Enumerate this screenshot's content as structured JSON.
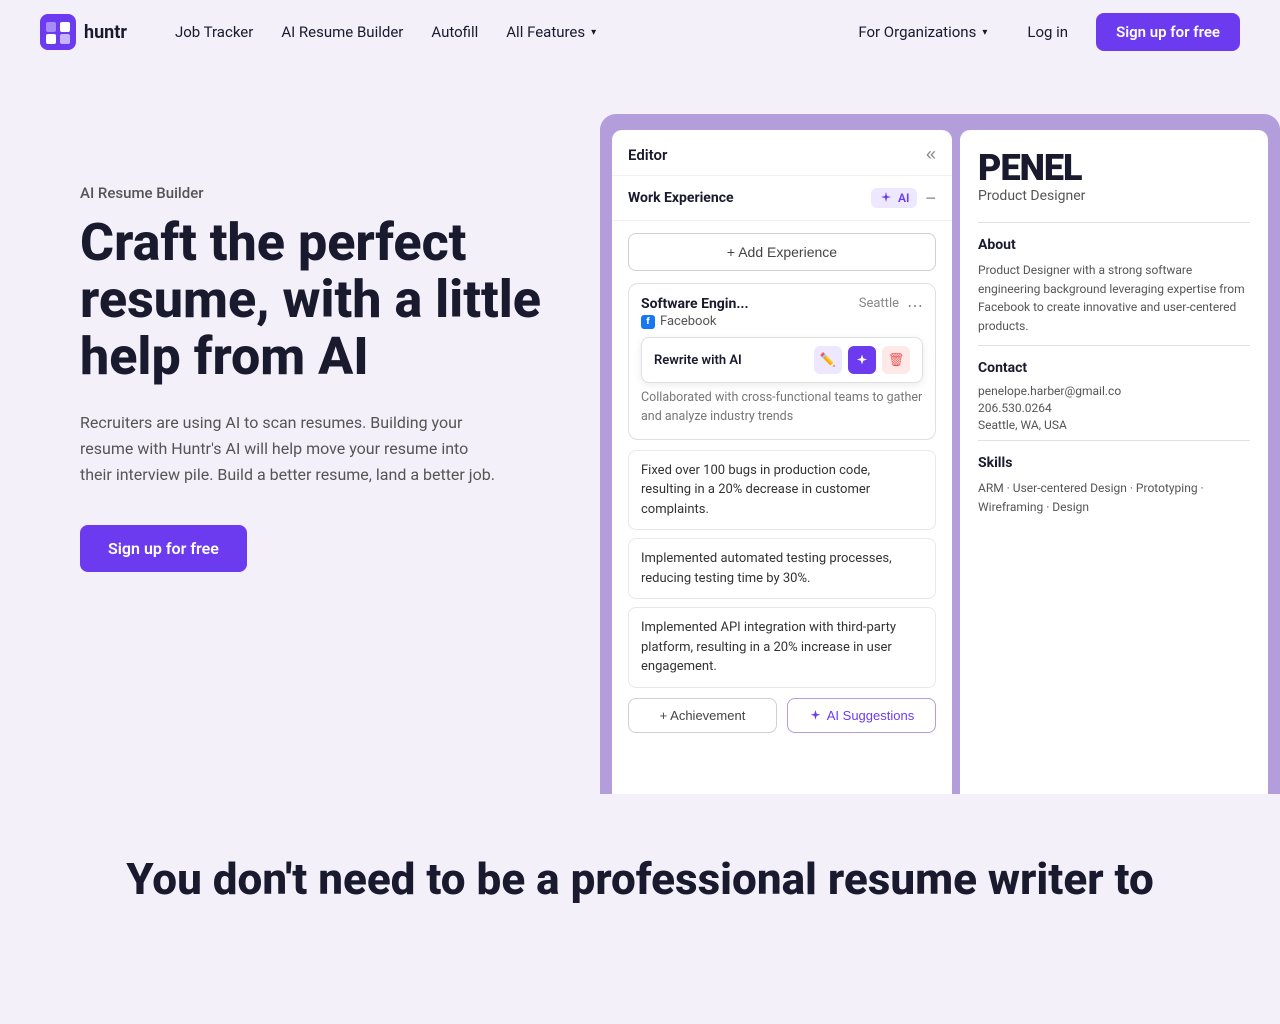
{
  "nav": {
    "logo_text": "huntr",
    "links": [
      {
        "label": "Job Tracker",
        "id": "job-tracker",
        "has_dropdown": false
      },
      {
        "label": "AI Resume Builder",
        "id": "ai-resume-builder",
        "has_dropdown": false
      },
      {
        "label": "Autofill",
        "id": "autofill",
        "has_dropdown": false
      },
      {
        "label": "All Features",
        "id": "all-features",
        "has_dropdown": true
      }
    ],
    "right": {
      "org_label": "For Organizations",
      "login_label": "Log in",
      "signup_label": "Sign up for free"
    }
  },
  "hero": {
    "subtitle": "AI Resume Builder",
    "title": "Craft the perfect resume, with a little help from AI",
    "description": "Recruiters are using AI to scan resumes. Building your resume with Huntr's AI will help move your resume into their interview pile. Build a better resume, land a better job.",
    "cta_label": "Sign up for free"
  },
  "editor": {
    "title": "Editor",
    "section_title": "Work Experience",
    "ai_badge": "AI",
    "add_experience_label": "+ Add Experience",
    "experience": {
      "title": "Software Engin...",
      "company": "Facebook",
      "location": "Seattle",
      "rewrite_label": "Rewrite with AI",
      "description": "Collaborated with cross-functional teams to gather and analyze industry trends"
    },
    "achievements": [
      "Fixed over 100 bugs in production code, resulting in a 20% decrease in customer complaints.",
      "Implemented automated testing processes, reducing testing time by 30%.",
      "Implemented API integration with third-party platform, resulting in a 20% increase in user engagement."
    ],
    "add_achievement_label": "+ Achievement",
    "ai_suggestions_label": "AI Suggestions"
  },
  "resume_preview": {
    "name": "PENEL",
    "role": "Product Designer",
    "about_title": "About",
    "about_text": "Product Designer with a strong software engineering background leveraging expertise from Facebook to create innovative and user-centered products.",
    "contact_title": "Contact",
    "contact_items": [
      "penelope.harber@gmail.co",
      "206.530.0264",
      "Seattle, WA, USA"
    ],
    "skills_title": "Skills",
    "skills_text": "ARM · User-centered Design · Prototyping · Wireframing · Design"
  },
  "bottom": {
    "title": "You don't need to be a professional resume writer to"
  }
}
